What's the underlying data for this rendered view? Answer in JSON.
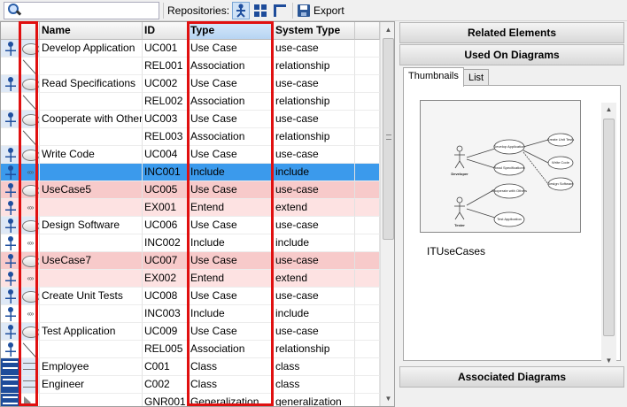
{
  "toolbar": {
    "search_value": "",
    "repositories_label": "Repositories:",
    "export_label": "Export"
  },
  "grid": {
    "columns": [
      "",
      "",
      "Name",
      "ID",
      "Type",
      "System Type"
    ],
    "sorted_column": "Type",
    "rows": [
      {
        "icon1": "actor-icon",
        "icon2": "use-case-icon",
        "name": "Develop Application",
        "id": "UC001",
        "type": "Use Case",
        "system_type": "use-case",
        "style": "blue"
      },
      {
        "icon1": "",
        "icon2": "association-icon",
        "name": "",
        "id": "REL001",
        "type": "Association",
        "system_type": "relationship",
        "style": ""
      },
      {
        "icon1": "actor-icon",
        "icon2": "use-case-icon",
        "name": "Read Specifications",
        "id": "UC002",
        "type": "Use Case",
        "system_type": "use-case",
        "style": "blue"
      },
      {
        "icon1": "",
        "icon2": "association-icon",
        "name": "",
        "id": "REL002",
        "type": "Association",
        "system_type": "relationship",
        "style": ""
      },
      {
        "icon1": "actor-icon",
        "icon2": "use-case-icon",
        "name": "Cooperate with Other",
        "id": "UC003",
        "type": "Use Case",
        "system_type": "use-case",
        "style": "blue"
      },
      {
        "icon1": "",
        "icon2": "association-icon",
        "name": "",
        "id": "REL003",
        "type": "Association",
        "system_type": "relationship",
        "style": ""
      },
      {
        "icon1": "actor-icon",
        "icon2": "use-case-icon",
        "name": "Write Code",
        "id": "UC004",
        "type": "Use Case",
        "system_type": "use-case",
        "style": "blue"
      },
      {
        "icon1": "actor-icon",
        "icon2": "include-icon",
        "name": "",
        "id": "INC001",
        "type": "Include",
        "system_type": "include",
        "style": "sel"
      },
      {
        "icon1": "actor-icon",
        "icon2": "use-case-icon",
        "name": "UseCase5",
        "id": "UC005",
        "type": "Use Case",
        "system_type": "use-case",
        "style": "pink"
      },
      {
        "icon1": "actor-icon",
        "icon2": "extend-icon",
        "name": "",
        "id": "EX001",
        "type": "Entend",
        "system_type": "extend",
        "style": "lpink"
      },
      {
        "icon1": "actor-icon",
        "icon2": "use-case-icon",
        "name": "Design Software",
        "id": "UC006",
        "type": "Use Case",
        "system_type": "use-case",
        "style": "blue"
      },
      {
        "icon1": "actor-icon",
        "icon2": "include-icon",
        "name": "",
        "id": "INC002",
        "type": "Include",
        "system_type": "include",
        "style": ""
      },
      {
        "icon1": "actor-icon",
        "icon2": "use-case-icon",
        "name": "UseCase7",
        "id": "UC007",
        "type": "Use Case",
        "system_type": "use-case",
        "style": "pink"
      },
      {
        "icon1": "actor-icon",
        "icon2": "extend-icon",
        "name": "",
        "id": "EX002",
        "type": "Entend",
        "system_type": "extend",
        "style": "lpink"
      },
      {
        "icon1": "actor-icon",
        "icon2": "use-case-icon",
        "name": "Create Unit Tests",
        "id": "UC008",
        "type": "Use Case",
        "system_type": "use-case",
        "style": "blue"
      },
      {
        "icon1": "actor-icon",
        "icon2": "include-icon",
        "name": "",
        "id": "INC003",
        "type": "Include",
        "system_type": "include",
        "style": ""
      },
      {
        "icon1": "actor-icon",
        "icon2": "use-case-icon",
        "name": "Test Application",
        "id": "UC009",
        "type": "Use Case",
        "system_type": "use-case",
        "style": "blue"
      },
      {
        "icon1": "actor-icon",
        "icon2": "association-icon",
        "name": "",
        "id": "REL005",
        "type": "Association",
        "system_type": "relationship",
        "style": ""
      },
      {
        "icon1": "class-icon",
        "icon2": "class-outline-icon",
        "name": "Employee",
        "id": "C001",
        "type": "Class",
        "system_type": "class",
        "style": "blue"
      },
      {
        "icon1": "class-icon",
        "icon2": "class-outline-icon",
        "name": "Engineer",
        "id": "C002",
        "type": "Class",
        "system_type": "class",
        "style": "blue"
      },
      {
        "icon1": "class-icon",
        "icon2": "generalization-icon",
        "name": "",
        "id": "GNR001",
        "type": "Generalization",
        "system_type": "generalization",
        "style": ""
      }
    ]
  },
  "right_panel": {
    "related_elements": "Related Elements",
    "used_on_diagrams": "Used On Diagrams",
    "tabs": [
      "Thumbnails",
      "List"
    ],
    "active_tab": "Thumbnails",
    "diagram_title": "ITUseCases",
    "thumbnail_labels": {
      "actor1": "Developer",
      "actor2": "Tester",
      "uc1": "Develop Application",
      "uc2": "Read Specifications",
      "uc3": "Cooperate with Others",
      "uc4": "Test Application",
      "uc5": "Create Unit Tests",
      "uc6": "Write Code",
      "uc7": "Design Software"
    },
    "associated_diagrams": "Associated Diagrams"
  }
}
